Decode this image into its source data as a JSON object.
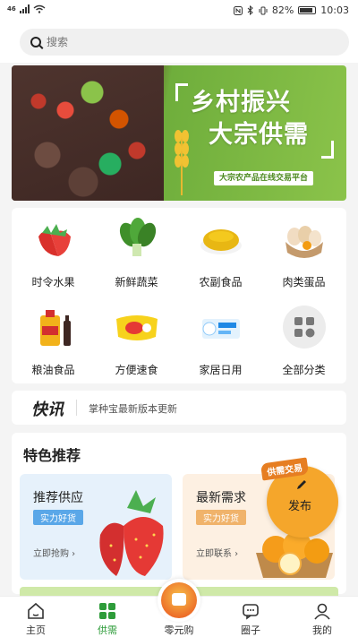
{
  "status_bar": {
    "signal_label": "46",
    "battery": "82%",
    "time": "10:03"
  },
  "search": {
    "placeholder": "搜索"
  },
  "banner": {
    "title_line1": "乡村振兴",
    "title_line2": "大宗供需",
    "subtitle": "大宗农产品在线交易平台",
    "accent_color": "#6fae3c"
  },
  "categories": [
    {
      "label": "时令水果",
      "icon": "strawberry-icon"
    },
    {
      "label": "新鲜蔬菜",
      "icon": "spinach-icon"
    },
    {
      "label": "农副食品",
      "icon": "millet-icon"
    },
    {
      "label": "肉类蛋品",
      "icon": "eggs-icon"
    },
    {
      "label": "粮油食品",
      "icon": "oil-bottle-icon"
    },
    {
      "label": "方便速食",
      "icon": "snack-icon"
    },
    {
      "label": "家居日用",
      "icon": "tissue-icon"
    },
    {
      "label": "全部分类",
      "icon": "grid-icon"
    }
  ],
  "news": {
    "tag": "快讯",
    "text": "掌种宝最新版本更新"
  },
  "featured": {
    "title": "特色推荐",
    "supply": {
      "title": "推荐供应",
      "badge": "实力好货",
      "link": "立即抢购"
    },
    "demand": {
      "title": "最新需求",
      "badge": "实力好货",
      "link": "立即联系"
    },
    "publish": {
      "ribbon": "供需交易",
      "label": "发布"
    }
  },
  "tabbar": {
    "active_color": "#2e9c3a",
    "items": [
      {
        "label": "主页",
        "icon": "home-icon"
      },
      {
        "label": "供需",
        "icon": "grid-icon"
      },
      {
        "label": "零元购",
        "icon": "gift-icon"
      },
      {
        "label": "圈子",
        "icon": "chat-icon"
      },
      {
        "label": "我的",
        "icon": "user-icon"
      }
    ]
  }
}
